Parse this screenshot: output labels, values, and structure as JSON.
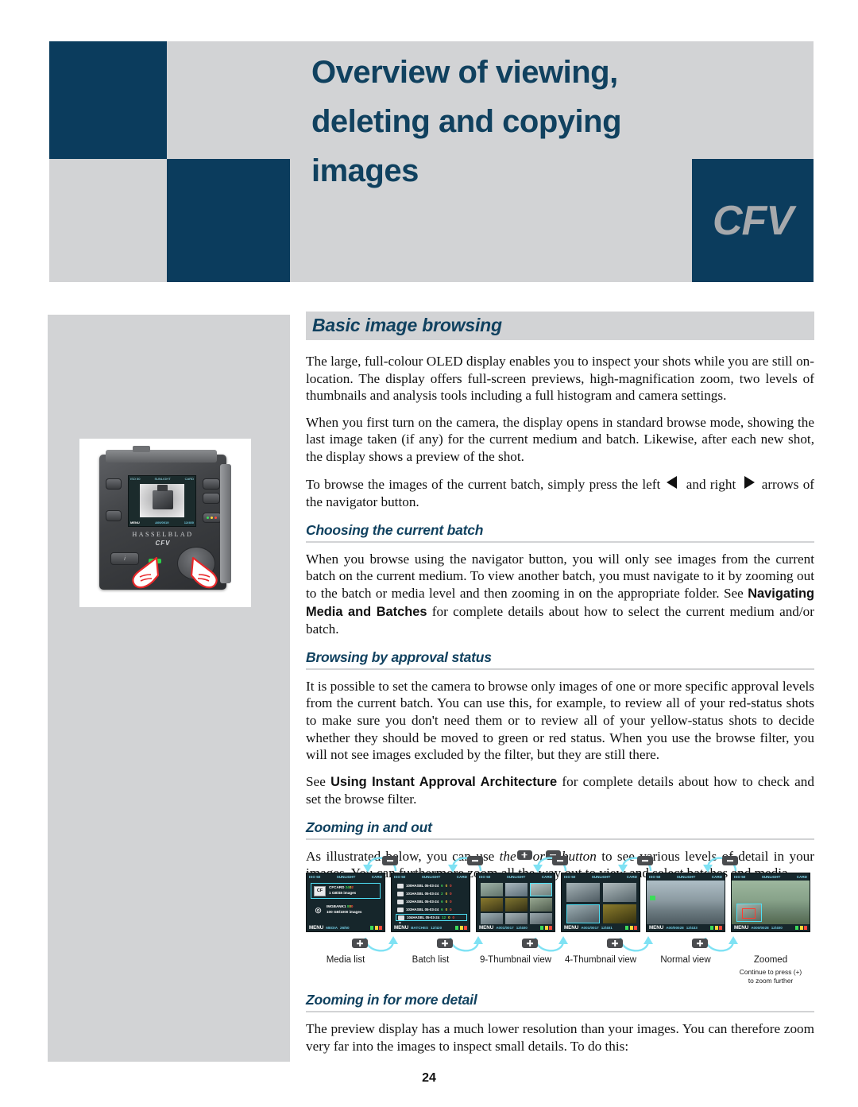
{
  "header": {
    "title_lines": [
      "Overview of viewing,",
      "deleting and copying",
      "images"
    ],
    "logo": "CFV",
    "bg_color": "#d2d3d5",
    "block_color": "#0b3c5d",
    "title_color": "#10415f",
    "logo_color": "#a7a9ac"
  },
  "camera_figure": {
    "brand": "HASSELBLAD",
    "model": "CFV",
    "info_button": "i",
    "screen": {
      "iso": "ISO 50",
      "wb": "SUNLIGHT",
      "media": "CARD",
      "menu": "MENU",
      "status_left": "A00/0019",
      "status_right": "12/400"
    }
  },
  "sections": {
    "main_title": "Basic image browsing",
    "p1": "The large, full-colour OLED display enables you to inspect your shots while you are still on-location. The display offers full-screen previews, high-magnification zoom, two levels of thumbnails and analysis tools including a full histogram and camera settings.",
    "p2": "When you first turn on the camera, the display opens in standard browse mode, showing the last image taken (if any) for the current medium and batch. Likewise, after each new shot, the display shows a preview of the shot.",
    "p3_a": "To browse the images of the current batch, simply press the left",
    "p3_b": "and right",
    "p3_c": "arrows of the navigator button.",
    "sub1_title": "Choosing the current batch",
    "sub1_p_a": "When you browse using the navigator button, you will only see images from the current batch on the current medium. To view another batch, you must navigate to it by zooming out to the batch or media level and then zooming in on the appropriate folder. See ",
    "sub1_p_bold": "Navigating Media and Batches",
    "sub1_p_b": " for complete details about how to select the current medium and/or batch.",
    "sub2_title": "Browsing by approval status",
    "sub2_p1": "It is possible to set the camera to browse only images of one or more specific approval levels from the current batch. You can use this, for example, to review all of your red-status shots to make sure you don't need them or to review all of your yellow-status shots to decide whether they should be moved to green or red status. When you use the browse filter, you will not see images excluded by the filter, but they are still there.",
    "sub2_p2_a": "See ",
    "sub2_p2_bold": "Using Instant Approval Architecture",
    "sub2_p2_b": " for complete details about how to check and set the browse filter.",
    "sub3_title": "Zooming in and out",
    "sub3_p_a": "As illustrated below, you can use ",
    "sub3_p_the": "the",
    "sub3_p_or": "or",
    "sub3_p_button": "button",
    "sub3_p_b": " to see various levels of detail in your images. You can furthermore zoom all the way out to view and select batches and media.",
    "sub4_title": "Zooming in for more detail",
    "sub4_p": "The preview display has a much lower resolution than your images. You can therefore zoom very far into the images to inspect small details. To do this:"
  },
  "diagram": {
    "zoom_out_label": "-",
    "zoom_in_label": "+",
    "captions": [
      "Media list",
      "Batch list",
      "9-Thumbnail view",
      "4-Thumbnail view",
      "Normal view",
      "Zoomed"
    ],
    "zoomed_note_line1": "Continue to press (+)",
    "zoomed_note_line2": "to zoom further",
    "panel_common": {
      "iso": "ISO 50",
      "wb": "SUNLIGHT",
      "media": "CARD",
      "menu": "MENU"
    },
    "panels": [
      {
        "name": "media-list",
        "bottom_mid": "MEDIA",
        "bottom_num": "26/50",
        "rows": [
          {
            "icon": "CF",
            "title": "CFCARD",
            "counts": [
              {
                "v": "24",
                "c": "g"
              },
              {
                "v": "0",
                "c": "y"
              },
              {
                "v": "2",
                "c": "r"
              }
            ],
            "sub": "1 GB/45 images",
            "selected": true
          },
          {
            "icon": "IB",
            "title": "IMGBANK1",
            "counts": [
              {
                "v": "0",
                "c": "g"
              },
              {
                "v": "0",
                "c": "y"
              },
              {
                "v": "0",
                "c": "r"
              }
            ],
            "sub": "100 GB/1000 images",
            "selected": false
          }
        ]
      },
      {
        "name": "batch-list",
        "bottom_mid": "BATCHES",
        "bottom_num": "12/420",
        "rows": [
          {
            "label": "100HASBL 05-03-24",
            "counts": [
              {
                "v": "6",
                "c": "g"
              },
              {
                "v": "0",
                "c": "y"
              },
              {
                "v": "0",
                "c": "r"
              }
            ],
            "selected": false
          },
          {
            "label": "101HASBL 05-03-24",
            "counts": [
              {
                "v": "2",
                "c": "g"
              },
              {
                "v": "0",
                "c": "y"
              },
              {
                "v": "0",
                "c": "r"
              }
            ],
            "selected": false
          },
          {
            "label": "102HASBL 05-03-24",
            "counts": [
              {
                "v": "6",
                "c": "g"
              },
              {
                "v": "0",
                "c": "y"
              },
              {
                "v": "0",
                "c": "r"
              }
            ],
            "selected": false
          },
          {
            "label": "103HASBL 05-03-24",
            "counts": [
              {
                "v": "6",
                "c": "g"
              },
              {
                "v": "0",
                "c": "y"
              },
              {
                "v": "0",
                "c": "r"
              }
            ],
            "selected": false
          },
          {
            "label": "104HASBL 05-03-24",
            "counts": [
              {
                "v": "12",
                "c": "g"
              },
              {
                "v": "0",
                "c": "y"
              },
              {
                "v": "0",
                "c": "r"
              }
            ],
            "selected": true
          }
        ]
      },
      {
        "name": "9-thumbnail",
        "bottom_mid": "A001/0017",
        "bottom_num": "12/400",
        "thumbs": 9,
        "selected_index": 2
      },
      {
        "name": "4-thumbnail",
        "bottom_mid": "A001/0017",
        "bottom_num": "12/401",
        "thumbs": 4,
        "selected_index": 2
      },
      {
        "name": "normal-view",
        "bottom_mid": "A00/00028",
        "bottom_num": "12/433",
        "thumbs": 1,
        "selected_index": -1
      },
      {
        "name": "zoomed-view",
        "bottom_mid": "A000/0028",
        "bottom_num": "12/400",
        "thumbs": 1,
        "selected_index": -1
      }
    ]
  },
  "footer": {
    "page_number": "24"
  },
  "colors": {
    "navy": "#0b3c5d",
    "heading": "#10415f",
    "gray_panel": "#d2d3d5",
    "cyan_arrow": "#7fe2f4",
    "approval_green": "#3ddc5a",
    "approval_yellow": "#ffd83b",
    "approval_red": "#ff4a3d"
  }
}
